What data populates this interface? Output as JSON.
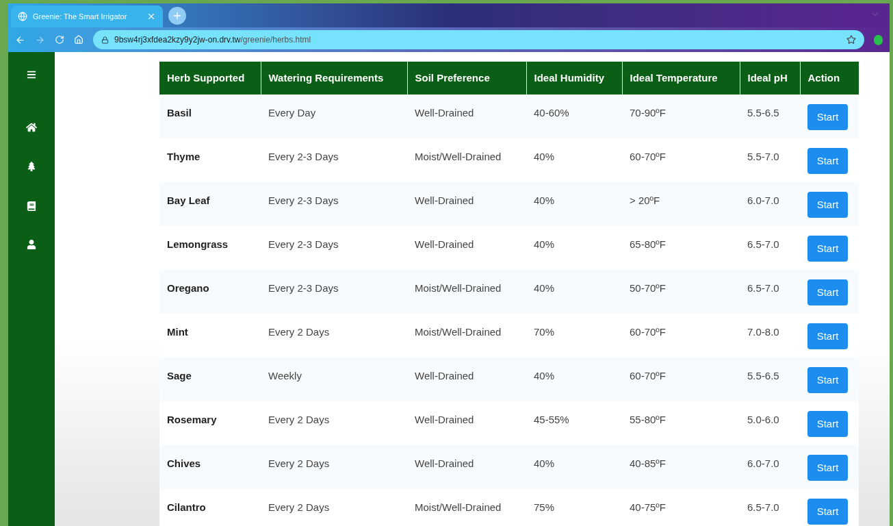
{
  "browser": {
    "tab": {
      "title": "Greenie: The Smart Irrigator",
      "selected": true
    },
    "address": {
      "host": "9bsw4rj3xfdea2kzy9y2jw-on.drv.tw",
      "path": "/greenie/herbs.html"
    }
  },
  "table": {
    "columns": [
      "Herb Supported",
      "Watering Requirements",
      "Soil Preference",
      "Ideal Humidity",
      "Ideal Temperature",
      "Ideal pH",
      "Action"
    ],
    "rows": [
      {
        "herb": "Basil",
        "watering": "Every Day",
        "soil": "Well-Drained",
        "humidity": "40-60%",
        "temperature": "70-90ºF",
        "ph": "5.5-6.5",
        "action": "Start"
      },
      {
        "herb": "Thyme",
        "watering": "Every 2-3 Days",
        "soil": "Moist/Well-Drained",
        "humidity": "40%",
        "temperature": "60-70ºF",
        "ph": "5.5-7.0",
        "action": "Start"
      },
      {
        "herb": "Bay Leaf",
        "watering": "Every 2-3 Days",
        "soil": "Well-Drained",
        "humidity": "40%",
        "temperature": "> 20ºF",
        "ph": "6.0-7.0",
        "action": "Start"
      },
      {
        "herb": "Lemongrass",
        "watering": "Every 2-3 Days",
        "soil": "Well-Drained",
        "humidity": "40%",
        "temperature": "65-80ºF",
        "ph": "6.5-7.0",
        "action": "Start"
      },
      {
        "herb": "Oregano",
        "watering": "Every 2-3 Days",
        "soil": "Moist/Well-Drained",
        "humidity": "40%",
        "temperature": "50-70ºF",
        "ph": "6.5-7.0",
        "action": "Start"
      },
      {
        "herb": "Mint",
        "watering": "Every 2 Days",
        "soil": "Moist/Well-Drained",
        "humidity": "70%",
        "temperature": "60-70ºF",
        "ph": "7.0-8.0",
        "action": "Start"
      },
      {
        "herb": "Sage",
        "watering": "Weekly",
        "soil": "Well-Drained",
        "humidity": "40%",
        "temperature": "60-70ºF",
        "ph": "5.5-6.5",
        "action": "Start"
      },
      {
        "herb": "Rosemary",
        "watering": "Every 2 Days",
        "soil": "Well-Drained",
        "humidity": "45-55%",
        "temperature": "55-80ºF",
        "ph": "5.0-6.0",
        "action": "Start"
      },
      {
        "herb": "Chives",
        "watering": "Every 2 Days",
        "soil": "Well-Drained",
        "humidity": "40%",
        "temperature": "40-85ºF",
        "ph": "6.0-7.0",
        "action": "Start"
      },
      {
        "herb": "Cilantro",
        "watering": "Every 2 Days",
        "soil": "Moist/Well-Drained",
        "humidity": "75%",
        "temperature": "40-75ºF",
        "ph": "6.5-7.0",
        "action": "Start"
      }
    ]
  }
}
